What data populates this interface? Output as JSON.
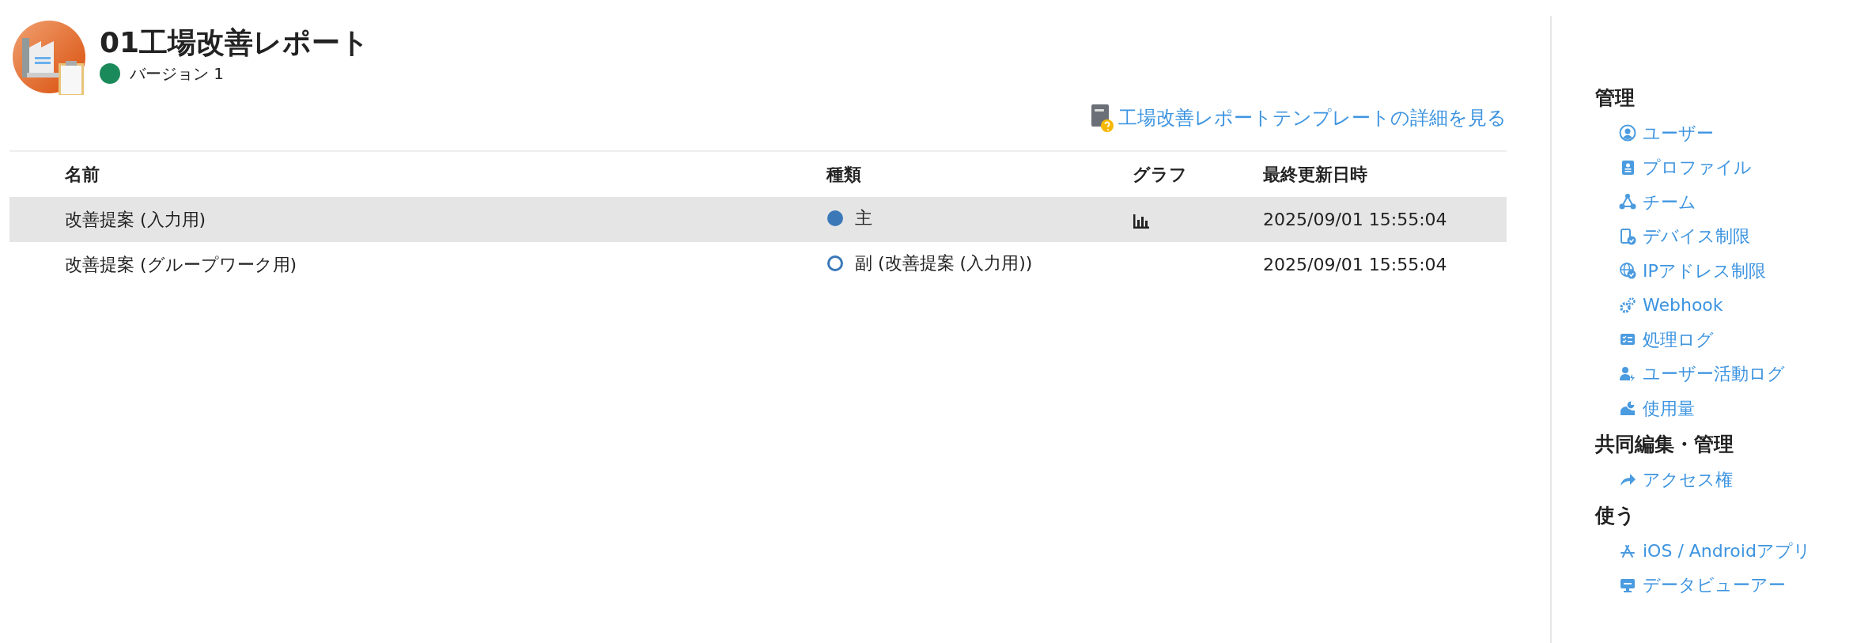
{
  "app": {
    "title": "01工場改善レポート",
    "version": {
      "label": "バージョン 1",
      "active": true
    },
    "template_link": "工場改善レポートテンプレートの詳細を見る"
  },
  "table": {
    "columns": [
      "名前",
      "種類",
      "グラフ",
      "最終更新日時"
    ],
    "rows": [
      {
        "name": "改善提案 (入力用)",
        "kind": "primary",
        "type_label": "主",
        "has_graph": true,
        "updated": "2025/09/01 15:55:04",
        "selected": true
      },
      {
        "name": "改善提案 (グループワーク用)",
        "kind": "secondary",
        "type_label": "副 (改善提案 (入力用))",
        "has_graph": false,
        "updated": "2025/09/01 15:55:04",
        "selected": false
      }
    ]
  },
  "sidebar": {
    "sections": [
      {
        "heading": "管理",
        "items": [
          "ユーザー",
          "プロファイル",
          "チーム",
          "デバイス制限",
          "IPアドレス制限",
          "Webhook",
          "処理ログ",
          "ユーザー活動ログ",
          "使用量"
        ]
      },
      {
        "heading": "共同編集・管理",
        "items": [
          "アクセス権"
        ]
      },
      {
        "heading": "使う",
        "items": [
          "iOS / Androidアプリ",
          "データビューアー"
        ]
      }
    ]
  }
}
